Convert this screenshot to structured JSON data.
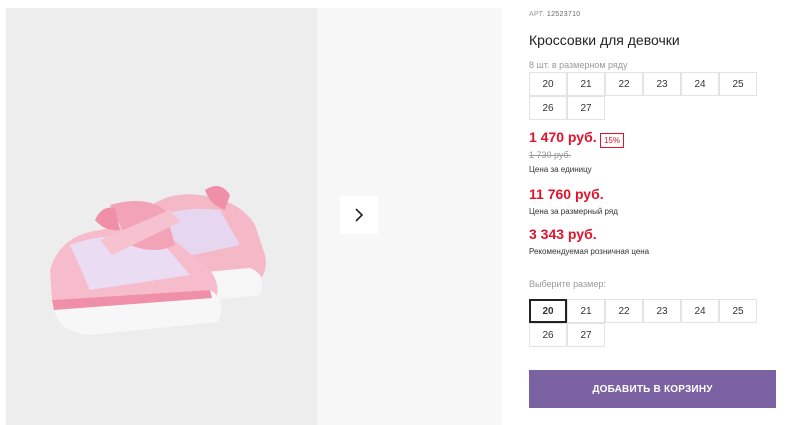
{
  "product": {
    "article_label": "АРТ.",
    "article_number": "12523710",
    "title": "Кроссовки для девочки",
    "qty_note": "8 шт. в размерном ряду",
    "size_row": [
      "20",
      "21",
      "22",
      "23",
      "24",
      "25",
      "26",
      "27"
    ],
    "price_unit": "1 470 руб.",
    "discount": "15%",
    "old_price": "1 730 руб.",
    "price_unit_caption": "Цена за единицу",
    "price_row": "11 760 руб.",
    "price_row_caption": "Цена за размерный ряд",
    "price_retail": "3 343 руб.",
    "price_retail_caption": "Рекомендуемая розничная цена",
    "choose_size_label": "Выберите размер:",
    "size_options": [
      "20",
      "21",
      "22",
      "23",
      "24",
      "25",
      "26",
      "27"
    ],
    "selected_size": "20",
    "add_to_cart_label": "ДОБАВИТЬ В КОРЗИНУ"
  },
  "gallery": {
    "next_icon": "chevron-right-icon"
  },
  "colors": {
    "price_red": "#e0122c",
    "button_purple": "#7b63a3"
  }
}
